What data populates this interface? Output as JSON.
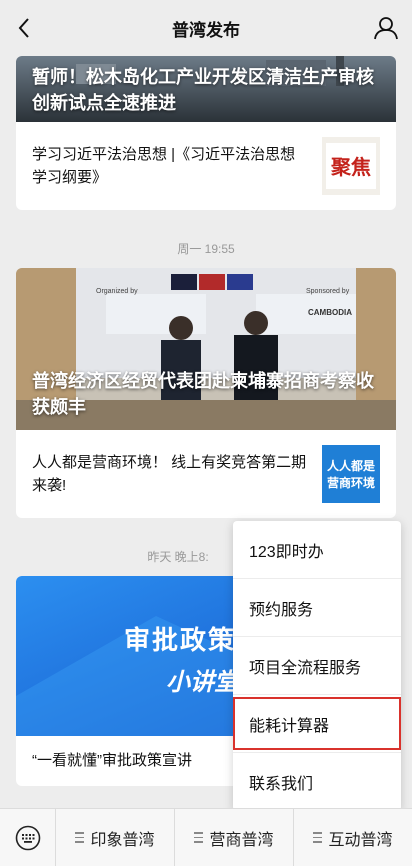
{
  "header": {
    "title": "普湾发布",
    "back_icon": "chevron-left-icon",
    "profile_icon": "user-icon"
  },
  "card1": {
    "headline": "暂师！松木岛化工产业开发区清洁生产审核创新试点全速推进",
    "sub_text": "学习习近平法治思想 |《习近平法治思想学习纲要》",
    "thumb_text": "聚焦",
    "thumb_color": "#c4221b"
  },
  "timestamp1": "周一 19:55",
  "card2": {
    "banner_left": "Organized by",
    "banner_right": "Sponsored by",
    "banner_center": "CAMBODIA",
    "headline": "普湾经济区经贸代表团赴柬埔寨招商考察收获颇丰",
    "sub_text": "人人都是营商环境！ 线上有奖竞答第二期来袭!",
    "thumb_text_line1": "人人都是",
    "thumb_text_line2": "营商环境",
    "thumb_color": "#1f7fd6"
  },
  "timestamp2": "昨天 晚上8:",
  "card3": {
    "banner_line1": "审批政策",
    "banner_line2": "小讲堂",
    "sub_text": "“一看就懂”审批政策宣讲"
  },
  "popup_menu": {
    "items": [
      {
        "label": "123即时办"
      },
      {
        "label": "预约服务"
      },
      {
        "label": "项目全流程服务"
      },
      {
        "label": "能耗计算器"
      },
      {
        "label": "联系我们"
      }
    ],
    "highlight_color": "#d9322c"
  },
  "bottom_menu": {
    "keyboard_icon": "keyboard-icon",
    "tabs": [
      {
        "label": "印象普湾"
      },
      {
        "label": "营商普湾"
      },
      {
        "label": "互动普湾"
      }
    ]
  }
}
